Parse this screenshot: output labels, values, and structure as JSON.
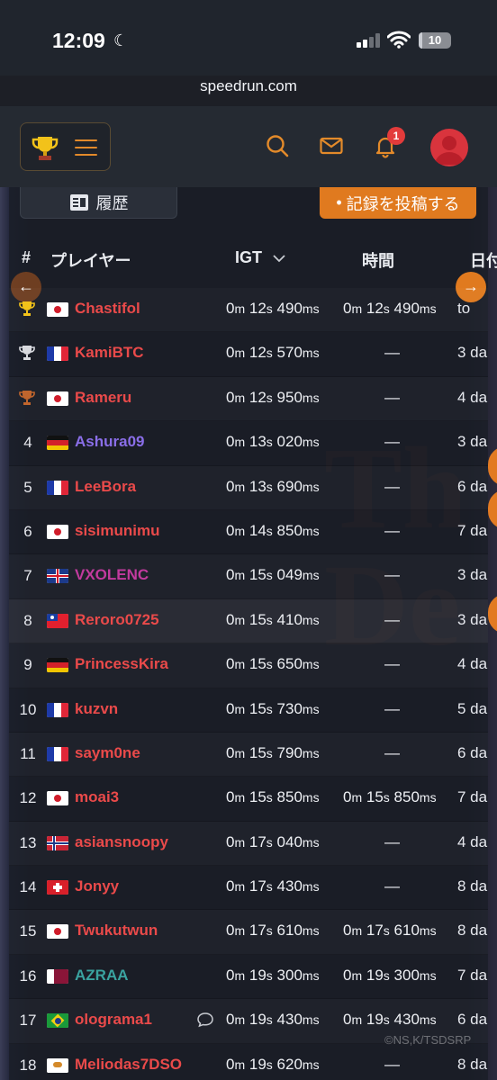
{
  "status": {
    "time": "12:09",
    "battery": "10",
    "battery_level": 0.1
  },
  "browser": {
    "url": "speedrun.com"
  },
  "header": {
    "notification_count": "1"
  },
  "controls": {
    "history_label": "履歴",
    "submit_label": "記録を投稿する"
  },
  "table": {
    "headers": {
      "rank": "#",
      "player": "プレイヤー",
      "igt": "IGT",
      "time": "時間",
      "date": "日付"
    },
    "rows": [
      {
        "rank": "1",
        "trophy": "gold",
        "flag": "jp",
        "player": "Chastifol",
        "player_color": "#ea4a4a",
        "igt": [
          "0",
          "12",
          "490"
        ],
        "rta": [
          "0",
          "12",
          "490"
        ],
        "date": "to"
      },
      {
        "rank": "2",
        "trophy": "silver",
        "flag": "fr",
        "player": "KamiBTC",
        "player_color": "#ea4a4a",
        "igt": [
          "0",
          "12",
          "570"
        ],
        "rta": null,
        "date": "3 da"
      },
      {
        "rank": "3",
        "trophy": "bronze",
        "flag": "jp",
        "player": "Rameru",
        "player_color": "#ea4a4a",
        "igt": [
          "0",
          "12",
          "950"
        ],
        "rta": null,
        "date": "4 da"
      },
      {
        "rank": "4",
        "trophy": null,
        "flag": "de",
        "player": "Ashura09",
        "player_color": "#8a6ee8",
        "igt": [
          "0",
          "13",
          "020"
        ],
        "rta": null,
        "date": "3 da"
      },
      {
        "rank": "5",
        "trophy": null,
        "flag": "fr",
        "player": "LeeBora",
        "player_color": "#ea4a4a",
        "igt": [
          "0",
          "13",
          "690"
        ],
        "rta": null,
        "date": "6 da"
      },
      {
        "rank": "6",
        "trophy": null,
        "flag": "jp",
        "player": "sisimunimu",
        "player_color": "#ea4a4a",
        "igt": [
          "0",
          "14",
          "850"
        ],
        "rta": null,
        "date": "7 da"
      },
      {
        "rank": "7",
        "trophy": null,
        "flag": "gb",
        "player": "VXOLENC",
        "player_color": "#c23a9e",
        "igt": [
          "0",
          "15",
          "049"
        ],
        "rta": null,
        "date": "3 da"
      },
      {
        "rank": "8",
        "trophy": null,
        "flag": "tw",
        "player": "Reroro0725",
        "player_color": "#ea4a4a",
        "igt": [
          "0",
          "15",
          "410"
        ],
        "rta": null,
        "date": "3 da",
        "highlight": true
      },
      {
        "rank": "9",
        "trophy": null,
        "flag": "de",
        "player": "PrincessKira",
        "player_color": "#ea4a4a",
        "igt": [
          "0",
          "15",
          "650"
        ],
        "rta": null,
        "date": "4 da"
      },
      {
        "rank": "10",
        "trophy": null,
        "flag": "fr",
        "player": "kuzvn",
        "player_color": "#ea4a4a",
        "igt": [
          "0",
          "15",
          "730"
        ],
        "rta": null,
        "date": "5 da"
      },
      {
        "rank": "11",
        "trophy": null,
        "flag": "fr",
        "player": "saym0ne",
        "player_color": "#ea4a4a",
        "igt": [
          "0",
          "15",
          "790"
        ],
        "rta": null,
        "date": "6 da"
      },
      {
        "rank": "12",
        "trophy": null,
        "flag": "jp",
        "player": "moai3",
        "player_color": "#ea4a4a",
        "igt": [
          "0",
          "15",
          "850"
        ],
        "rta": [
          "0",
          "15",
          "850"
        ],
        "date": "7 da"
      },
      {
        "rank": "13",
        "trophy": null,
        "flag": "no",
        "player": "asiansnoopy",
        "player_color": "#ea4a4a",
        "igt": [
          "0",
          "17",
          "040"
        ],
        "rta": null,
        "date": "4 da"
      },
      {
        "rank": "14",
        "trophy": null,
        "flag": "ch",
        "player": "Jonyy",
        "player_color": "#ea4a4a",
        "igt": [
          "0",
          "17",
          "430"
        ],
        "rta": null,
        "date": "8 da"
      },
      {
        "rank": "15",
        "trophy": null,
        "flag": "jp",
        "player": "Twukutwun",
        "player_color": "#ea4a4a",
        "igt": [
          "0",
          "17",
          "610"
        ],
        "rta": [
          "0",
          "17",
          "610"
        ],
        "date": "8 da"
      },
      {
        "rank": "16",
        "trophy": null,
        "flag": "qa",
        "player": "AZRAA",
        "player_color": "#3aa3a0",
        "igt": [
          "0",
          "19",
          "300"
        ],
        "rta": [
          "0",
          "19",
          "300"
        ],
        "date": "7 da"
      },
      {
        "rank": "17",
        "trophy": null,
        "flag": "br",
        "player": "olograma1",
        "player_color": "#ea4a4a",
        "igt": [
          "0",
          "19",
          "430"
        ],
        "rta": [
          "0",
          "19",
          "430"
        ],
        "date": "6 da",
        "comment": true
      },
      {
        "rank": "18",
        "trophy": null,
        "flag": "cy",
        "player": "Meliodas7DSO",
        "player_color": "#ea4a4a",
        "igt": [
          "0",
          "19",
          "620"
        ],
        "rta": null,
        "date": "8 da"
      }
    ]
  },
  "watermark": "©NS,K/TSDSRP"
}
